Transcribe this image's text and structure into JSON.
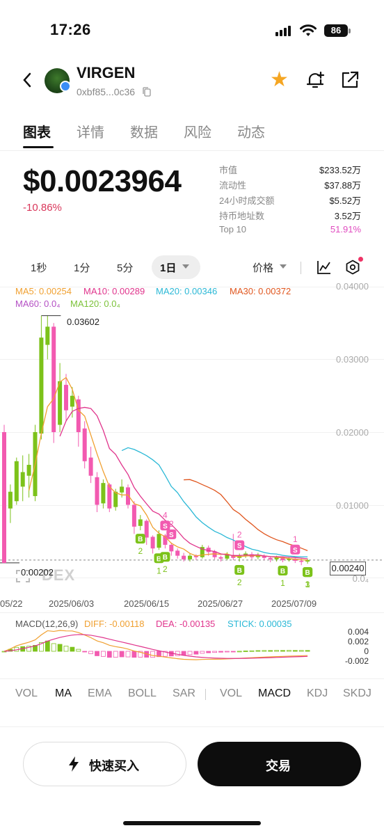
{
  "status": {
    "time": "17:26",
    "battery": "86"
  },
  "token": {
    "name": "VIRGEN",
    "address": "0xbf85...0c36"
  },
  "tabs": [
    "图表",
    "详情",
    "数据",
    "风险",
    "动态"
  ],
  "price": {
    "value": "$0.0023964",
    "change": "-10.86%"
  },
  "stats": [
    {
      "label": "市值",
      "value": "$233.52万"
    },
    {
      "label": "流动性",
      "value": "$37.88万"
    },
    {
      "label": "24小时成交额",
      "value": "$5.52万"
    },
    {
      "label": "持币地址数",
      "value": "3.52万"
    },
    {
      "label": "Top 10",
      "value": "51.91%"
    }
  ],
  "intervals": [
    "1秒",
    "1分",
    "5分"
  ],
  "interval_active": "1日",
  "price_select": "价格",
  "ma_legend": {
    "ma5": "MA5: 0.00254",
    "ma10": "MA10: 0.00289",
    "ma20": "MA20: 0.00346",
    "ma30": "MA30: 0.00372",
    "ma60": "MA60: 0.0₄",
    "ma120": "MA120: 0.0₄"
  },
  "colors": {
    "ma5": "#f0a030",
    "ma10": "#e0348c",
    "ma20": "#2ab8d6",
    "ma30": "#e0561e",
    "ma60": "#b44fc4",
    "ma120": "#7cc23a",
    "up": "#7cc21a",
    "down": "#f25ab0"
  },
  "markers": {
    "high": "0.03602",
    "low": "0.00202",
    "current": "0.00240",
    "watermark": "DEX"
  },
  "macd_legend": {
    "title": "MACD(12,26,9)",
    "diff": "DIFF: -0.00118",
    "dea": "DEA: -0.00135",
    "stick": "STICK: 0.00035"
  },
  "indicators": [
    "VOL",
    "MA",
    "EMA",
    "BOLL",
    "SAR",
    "VOL",
    "MACD",
    "KDJ",
    "SKDJ"
  ],
  "buttons": {
    "quick_buy": "快速买入",
    "trade": "交易"
  },
  "chart_data": {
    "type": "candlestick",
    "x_ticks": [
      "05/22",
      "2025/06/03",
      "2025/06/15",
      "2025/06/27",
      "2025/07/09"
    ],
    "y_ticks": [
      "0.04000",
      "0.03000",
      "0.02000",
      "0.01000",
      "0.0₄"
    ],
    "macd_y_ticks": [
      "0.004",
      "0.002",
      "0",
      "-0.002"
    ],
    "ylim": [
      0,
      0.04
    ],
    "high": 0.03602,
    "low": 0.00202,
    "last": 0.0024,
    "trade_markers": [
      {
        "type": "B",
        "count": "2"
      },
      {
        "type": "B",
        "count": "1"
      },
      {
        "type": "B",
        "count": "2"
      },
      {
        "type": "S",
        "count": "4"
      },
      {
        "type": "S",
        "count": "2"
      },
      {
        "type": "B",
        "count": "2"
      },
      {
        "type": "S",
        "count": "2"
      },
      {
        "type": "B",
        "count": "1"
      },
      {
        "type": "S",
        "count": "1"
      },
      {
        "type": "B",
        "count": "1"
      },
      {
        "type": "B",
        "count": "1"
      },
      {
        "type": "B",
        "count": "3"
      }
    ],
    "candles": [
      [
        0.02,
        0.002,
        0.021,
        0.002
      ],
      [
        0.0095,
        0.0118,
        0.0128,
        0.0075
      ],
      [
        0.0105,
        0.016,
        0.0165,
        0.01
      ],
      [
        0.0125,
        0.0145,
        0.0168,
        0.0105
      ],
      [
        0.014,
        0.0155,
        0.017,
        0.011
      ],
      [
        0.0112,
        0.02,
        0.021,
        0.0105
      ],
      [
        0.0198,
        0.033,
        0.036,
        0.019
      ],
      [
        0.032,
        0.0345,
        0.036,
        0.03
      ],
      [
        0.0345,
        0.02,
        0.035,
        0.0185
      ],
      [
        0.021,
        0.027,
        0.0295,
        0.02
      ],
      [
        0.0265,
        0.023,
        0.028,
        0.0215
      ],
      [
        0.0235,
        0.025,
        0.0262,
        0.022
      ],
      [
        0.0245,
        0.02,
        0.025,
        0.018
      ],
      [
        0.0205,
        0.016,
        0.0215,
        0.015
      ],
      [
        0.0165,
        0.014,
        0.018,
        0.013
      ],
      [
        0.0138,
        0.01,
        0.0145,
        0.009
      ],
      [
        0.0102,
        0.013,
        0.0135,
        0.0095
      ],
      [
        0.0128,
        0.0095,
        0.013,
        0.009
      ],
      [
        0.0097,
        0.0118,
        0.0122,
        0.0092
      ],
      [
        0.0117,
        0.0125,
        0.0135,
        0.011
      ],
      [
        0.0124,
        0.01,
        0.0128,
        0.0095
      ],
      [
        0.01,
        0.007,
        0.0105,
        0.006
      ],
      [
        0.0071,
        0.008,
        0.0086,
        0.0065
      ],
      [
        0.0078,
        0.0055,
        0.008,
        0.0045
      ],
      [
        0.0056,
        0.004,
        0.0058,
        0.0033
      ],
      [
        0.0041,
        0.006,
        0.0065,
        0.0038
      ],
      [
        0.0058,
        0.0045,
        0.006,
        0.004
      ],
      [
        0.0045,
        0.0036,
        0.0048,
        0.003
      ],
      [
        0.0037,
        0.003,
        0.004,
        0.0026
      ],
      [
        0.003,
        0.0025,
        0.0034,
        0.0022
      ],
      [
        0.0025,
        0.003,
        0.0033,
        0.0022
      ],
      [
        0.003,
        0.0028,
        0.0032,
        0.0024
      ],
      [
        0.0028,
        0.0042,
        0.0045,
        0.0026
      ],
      [
        0.0041,
        0.0035,
        0.0044,
        0.003
      ],
      [
        0.0036,
        0.0028,
        0.0038,
        0.0025
      ],
      [
        0.0028,
        0.0026,
        0.003,
        0.0022
      ],
      [
        0.0026,
        0.0032,
        0.0035,
        0.0024
      ],
      [
        0.0031,
        0.0027,
        0.006,
        0.0024
      ],
      [
        0.0027,
        0.003,
        0.0033,
        0.0022
      ],
      [
        0.003,
        0.0033,
        0.0036,
        0.0027
      ],
      [
        0.0032,
        0.0028,
        0.0035,
        0.0025
      ],
      [
        0.0028,
        0.0031,
        0.0034,
        0.0025
      ],
      [
        0.003,
        0.0027,
        0.0032,
        0.0024
      ],
      [
        0.0027,
        0.0025,
        0.0029,
        0.0021
      ],
      [
        0.0025,
        0.0028,
        0.003,
        0.0022
      ],
      [
        0.0028,
        0.0024,
        0.0029,
        0.0021
      ],
      [
        0.0024,
        0.0026,
        0.0028,
        0.0022
      ],
      [
        0.0026,
        0.0023,
        0.0027,
        0.002
      ],
      [
        0.0023,
        0.0022,
        0.0026,
        0.0017
      ],
      [
        0.0022,
        0.0024,
        0.0026,
        0.0019
      ]
    ]
  }
}
